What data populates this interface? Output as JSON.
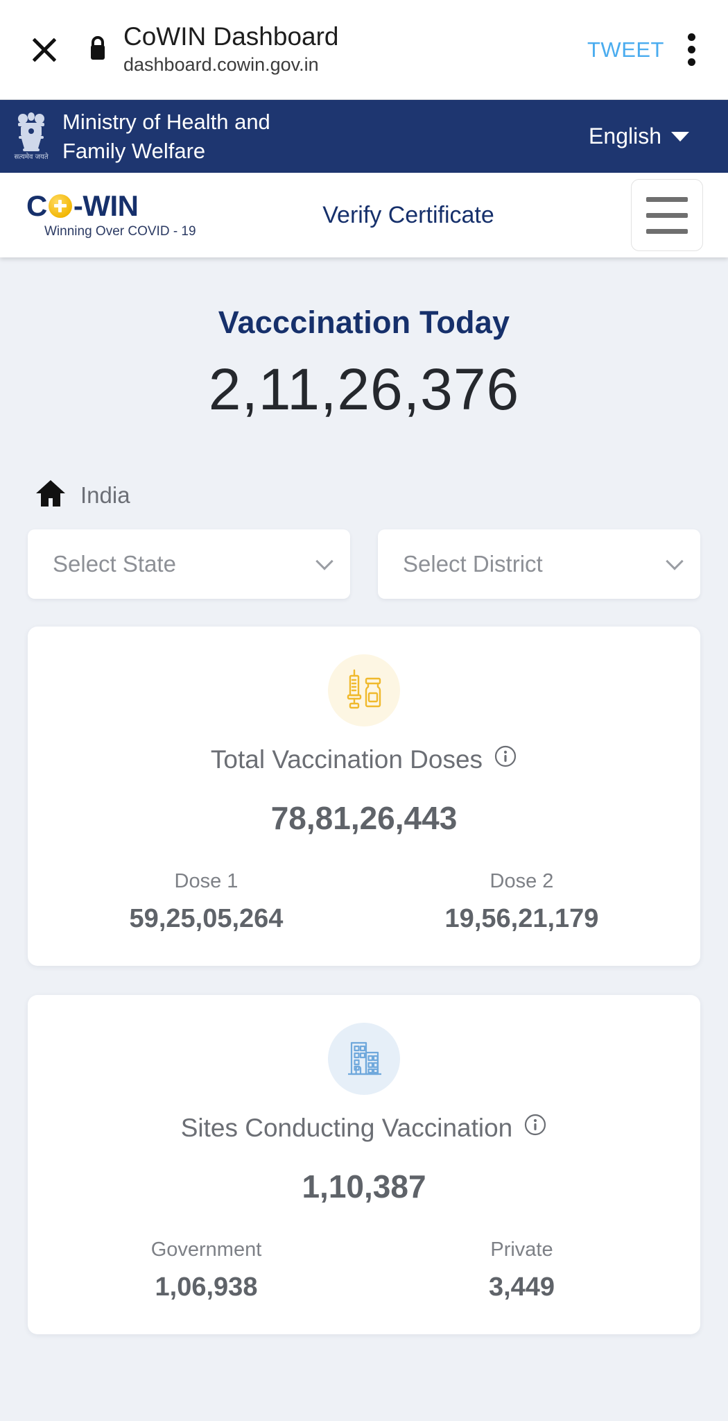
{
  "browser": {
    "close_icon": "close-icon",
    "lock_icon": "lock-icon",
    "tab_title": "CoWIN Dashboard",
    "tab_url": "dashboard.cowin.gov.in",
    "tweet_label": "TWEET",
    "menu_icon": "kebab-menu-icon"
  },
  "gov_header": {
    "emblem_icon": "india-state-emblem-icon",
    "ministry_line1": "Ministry of Health and",
    "ministry_line2": "Family Welfare",
    "language": "English",
    "caret_icon": "caret-down-icon",
    "background_color": "#1e3670"
  },
  "site_nav": {
    "brand_part1": "C",
    "brand_part2": "-WIN",
    "brand_o_icon": "plus-circle-icon",
    "brand_tagline": "Winning Over COVID - 19",
    "verify_link": "Verify Certificate",
    "menu_icon": "hamburger-menu-icon",
    "brand_color": "#16306b"
  },
  "hero": {
    "title": "Vacccination Today",
    "value": "2,11,26,376"
  },
  "breadcrumb": {
    "home_icon": "home-icon",
    "label": "India"
  },
  "filters": {
    "state_placeholder": "Select State",
    "district_placeholder": "Select District",
    "chevron_icon": "chevron-down-icon"
  },
  "cards": [
    {
      "icon": "syringe-vial-icon",
      "icon_color": "#f0b92c",
      "title": "Total Vaccination Doses",
      "info_icon": "info-icon",
      "total": "78,81,26,443",
      "splits": [
        {
          "label": "Dose 1",
          "value": "59,25,05,264"
        },
        {
          "label": "Dose 2",
          "value": "19,56,21,179"
        }
      ]
    },
    {
      "icon": "building-icon",
      "icon_color": "#6fa8dc",
      "title": "Sites Conducting Vaccination",
      "info_icon": "info-icon",
      "total": "1,10,387",
      "splits": [
        {
          "label": "Government",
          "value": "1,06,938"
        },
        {
          "label": "Private",
          "value": "3,449"
        }
      ]
    }
  ]
}
